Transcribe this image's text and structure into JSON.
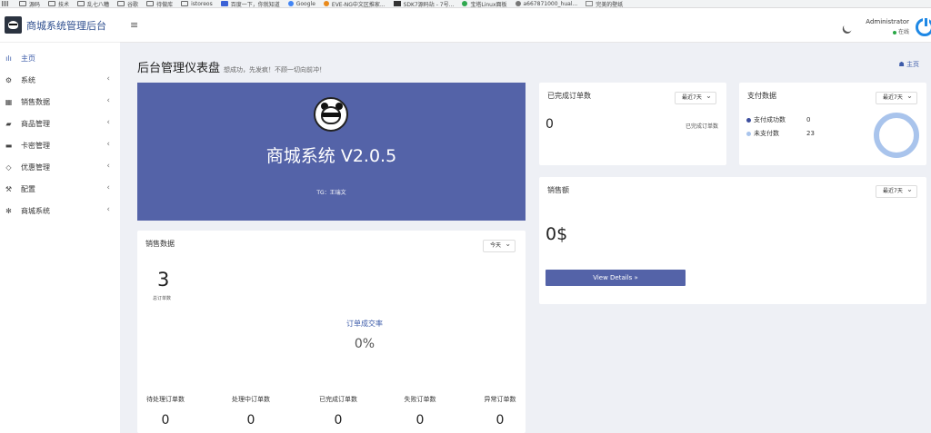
{
  "bookmarks": [
    {
      "label": "源码",
      "icon": "folder-icon"
    },
    {
      "label": "技术",
      "icon": "folder-icon"
    },
    {
      "label": "乱七八糟",
      "icon": "folder-icon"
    },
    {
      "label": "谷歌",
      "icon": "folder-icon"
    },
    {
      "label": "待做库",
      "icon": "folder-icon"
    },
    {
      "label": "istoreos",
      "icon": "folder-icon"
    },
    {
      "label": "百度一下，你就知道",
      "icon": "paw-icon"
    },
    {
      "label": "Google",
      "icon": "google-icon"
    },
    {
      "label": "EVE-NG中文区推家...",
      "icon": "orange-site-icon"
    },
    {
      "label": "SDK7源码站 - 7号...",
      "icon": "sdk-site-icon"
    },
    {
      "label": "宝塔Linux面板",
      "icon": "bt-panel-icon"
    },
    {
      "label": "a667871000_hual...",
      "icon": "avatar-site-icon"
    },
    {
      "label": "完美的壁纸",
      "icon": "image-site-icon"
    }
  ],
  "app": {
    "brand": "商城系统管理后台"
  },
  "nav": [
    {
      "label": "主页",
      "icon": "chart-bars-icon",
      "icon_glyph": "ılı",
      "active": true
    },
    {
      "label": "系统",
      "icon": "gear-icon",
      "icon_glyph": "⚙",
      "chevron": "‹"
    },
    {
      "label": "销售数据",
      "icon": "table-icon",
      "icon_glyph": "▦",
      "chevron": "‹"
    },
    {
      "label": "商品管理",
      "icon": "shopping-bag-icon",
      "icon_glyph": "▰",
      "chevron": "‹"
    },
    {
      "label": "卡密管理",
      "icon": "credit-card-icon",
      "icon_glyph": "▬",
      "chevron": "‹"
    },
    {
      "label": "优惠管理",
      "icon": "diamond-icon",
      "icon_glyph": "◇",
      "chevron": "‹"
    },
    {
      "label": "配置",
      "icon": "wrench-icon",
      "icon_glyph": "⚒",
      "chevron": "‹"
    },
    {
      "label": "商城系统",
      "icon": "cog-icon",
      "icon_glyph": "✻",
      "chevron": "‹"
    }
  ],
  "topbar": {
    "menu_glyph": "≡",
    "user_name": "Administrator",
    "user_status": "在线"
  },
  "page": {
    "title": "后台管理仪表盘",
    "subtitle": "想成功，先发疯！不顾一切向前冲！",
    "crumb": "☗ 主页"
  },
  "hero": {
    "title": "商城系统 V2.0.5",
    "tg": "TG：王瑞文"
  },
  "sales": {
    "title": "销售数据",
    "select": "今天",
    "total_orders": "3",
    "total_orders_label": "总订单数",
    "rate_label": "订单成交率",
    "rate_value": "0%",
    "stats": [
      {
        "label": "待处理订单数",
        "value": "0"
      },
      {
        "label": "处理中订单数",
        "value": "0"
      },
      {
        "label": "已完成订单数",
        "value": "0"
      },
      {
        "label": "失败订单数",
        "value": "0"
      },
      {
        "label": "异常订单数",
        "value": "0"
      }
    ]
  },
  "orders": {
    "title": "已完成订单数",
    "select": "最近7天",
    "value": "0",
    "label": "已完成订单数"
  },
  "pay": {
    "title": "支付数据",
    "select": "最近7天",
    "legend": [
      {
        "label": "支付成功数",
        "value": "0",
        "color": "#3d4e9e"
      },
      {
        "label": "未支付数",
        "value": "23",
        "color": "#a9c4ec"
      }
    ]
  },
  "revenue": {
    "title": "销售额",
    "select": "最近7天",
    "value": "0$",
    "button": "View Details »"
  },
  "colors": {
    "primary": "#5463a8",
    "accent": "#3c5ba9",
    "online": "#28a745",
    "power": "#1e88e5"
  }
}
